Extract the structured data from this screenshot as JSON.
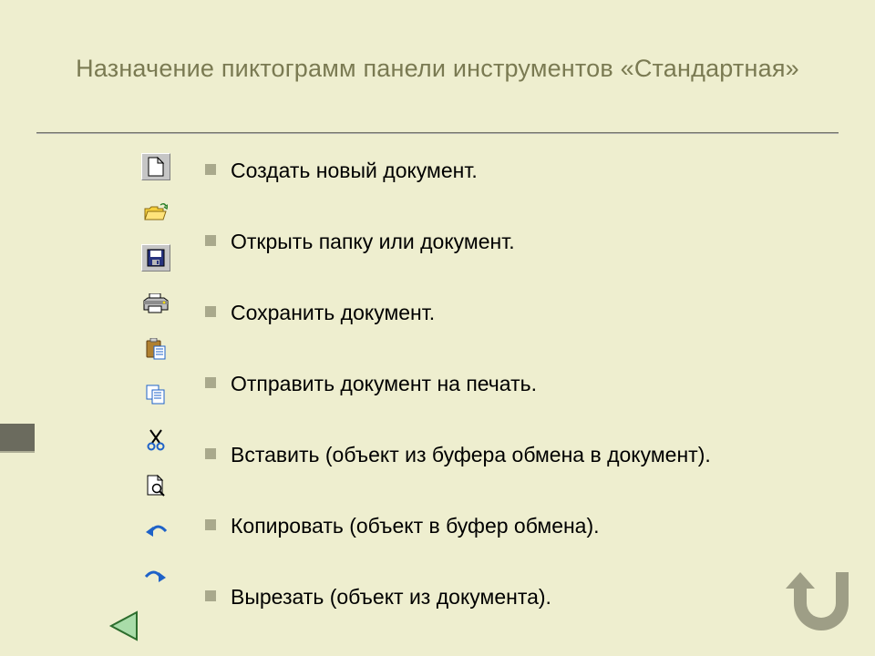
{
  "title": "Назначение пиктограмм панели инструментов «Стандартная»",
  "items": [
    {
      "icon": "new-file-icon",
      "label": "Создать новый документ."
    },
    {
      "icon": "open-folder-icon",
      "label": "Открыть папку или документ."
    },
    {
      "icon": "save-icon",
      "label": "Сохранить документ."
    },
    {
      "icon": "print-icon",
      "label": "Отправить документ на печать."
    },
    {
      "icon": "paste-icon",
      "label": "Вставить (объект из буфера обмена в документ)."
    },
    {
      "icon": "copy-icon",
      "label": "Копировать (объект в буфер обмена)."
    },
    {
      "icon": "cut-icon",
      "label": "Вырезать (объект из документа)."
    }
  ],
  "extra_icons": [
    "preview-icon",
    "undo-icon",
    "redo-icon"
  ],
  "colors": {
    "bg": "#eeeecf",
    "title": "#7a7a52",
    "bullet": "#a9a98c",
    "button_face": "#c6c6c6",
    "accent_blue": "#1e62c8",
    "accent_yellow": "#f5cf3c",
    "back_fill": "#a9dca9",
    "return_fill": "#9e9e86"
  }
}
